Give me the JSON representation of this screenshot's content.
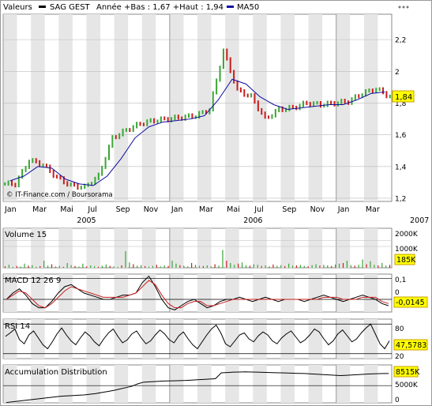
{
  "header": {
    "label_valeurs": "Valeurs",
    "series_name": "SAG GEST",
    "range_text": "Année +Bas : 1,67 +Haut : 1,94",
    "ma_label": "MA50",
    "credit": "© IT-Finance.com / Boursorama"
  },
  "colors": {
    "grid_band": "#e6e6e6",
    "up": "#3aa535",
    "down": "#c81e1e",
    "ma": "#1010a0",
    "badge_bg": "#ffff00",
    "badge_border": "#c8a000"
  },
  "icons": {
    "dots": "three-dots-icon"
  },
  "chart_data": [
    {
      "type": "line",
      "name": "price",
      "x": [
        "2005-01",
        "2005-02",
        "2005-03",
        "2005-04",
        "2005-05",
        "2005-06",
        "2005-07",
        "2005-08",
        "2005-09",
        "2005-10",
        "2005-11",
        "2005-12",
        "2006-01",
        "2006-02",
        "2006-03",
        "2006-04",
        "2006-05",
        "2006-06",
        "2006-07",
        "2006-08",
        "2006-09",
        "2006-10",
        "2006-11",
        "2006-12",
        "2007-01",
        "2007-02",
        "2007-03",
        "2007-04"
      ],
      "series": [
        {
          "values": [
            1.29,
            1.44,
            1.41,
            1.33,
            1.28,
            1.27,
            1.34,
            1.58,
            1.63,
            1.67,
            1.69,
            1.7,
            1.71,
            1.72,
            1.76,
            2.13,
            1.88,
            1.84,
            1.7,
            1.76,
            1.77,
            1.8,
            1.79,
            1.8,
            1.81,
            1.86,
            1.89,
            1.84
          ]
        },
        {
          "name": "MA50",
          "values": [
            1.31,
            1.34,
            1.4,
            1.39,
            1.32,
            1.29,
            1.28,
            1.34,
            1.45,
            1.58,
            1.65,
            1.68,
            1.69,
            1.7,
            1.72,
            1.82,
            1.95,
            1.92,
            1.84,
            1.79,
            1.76,
            1.77,
            1.78,
            1.79,
            1.79,
            1.82,
            1.86,
            1.87
          ]
        }
      ],
      "ylim": [
        1.18,
        2.36
      ],
      "y_ticks": [
        "1,2",
        "1,4",
        "1,6",
        "1,8",
        "2",
        "2,2"
      ],
      "x_tick_labels": [
        "Jan",
        "Mar",
        "Mai",
        "Jul",
        "Sep",
        "Nov",
        "Jan",
        "Mar",
        "Mai",
        "Jul",
        "Sep",
        "Nov",
        "Jan",
        "Mar"
      ],
      "year_labels": [
        "2005",
        "2006",
        "2007"
      ],
      "last_value_label": "1,84"
    },
    {
      "type": "bar",
      "title": "Volume 15",
      "values": [
        12,
        25,
        8,
        15,
        10,
        35,
        18,
        22,
        9,
        14,
        60,
        18,
        30,
        12,
        16,
        8,
        40,
        22,
        15,
        10,
        35,
        12,
        20,
        14,
        9,
        18,
        28,
        16,
        12,
        8,
        20,
        140,
        45,
        30,
        18,
        22,
        14,
        10,
        16,
        25,
        12,
        20,
        15,
        60,
        35,
        22,
        18,
        12,
        40,
        25,
        16,
        14,
        20,
        12,
        30,
        18,
        150,
        60,
        40,
        25,
        35,
        45,
        22,
        18,
        30,
        25,
        15,
        20,
        12,
        28,
        16,
        22,
        14,
        35,
        18,
        20,
        24,
        16,
        12,
        22,
        30,
        18,
        25,
        20,
        15,
        28,
        35,
        40,
        60,
        22,
        18,
        26,
        70,
        30,
        55,
        25,
        20,
        40,
        18,
        25
      ],
      "y_ticks": [
        "2000K",
        "1000K",
        "0"
      ],
      "ylim": [
        0,
        2000
      ],
      "last_value_label": "185K"
    },
    {
      "type": "line",
      "title": "MACD 12 26 9",
      "series": [
        {
          "values": [
            0.0,
            0.03,
            0.05,
            0.02,
            -0.02,
            -0.04,
            -0.04,
            -0.01,
            0.03,
            0.06,
            0.07,
            0.05,
            0.03,
            0.02,
            0.01,
            0.0,
            0.0,
            0.01,
            0.02,
            0.02,
            0.03,
            0.08,
            0.11,
            0.06,
            0.0,
            -0.04,
            -0.05,
            -0.03,
            -0.01,
            0.0,
            -0.02,
            -0.04,
            -0.03,
            -0.01,
            0.0,
            0.0,
            0.01,
            0.0,
            -0.01,
            0.0,
            0.01,
            0.0,
            -0.01,
            0.0,
            0.0,
            0.0,
            -0.01,
            0.0,
            0.01,
            0.02,
            0.01,
            0.0,
            -0.01,
            0.0,
            0.01,
            0.02,
            0.01,
            0.0,
            -0.02,
            -0.03
          ]
        },
        {
          "values": [
            0.0,
            0.02,
            0.04,
            0.03,
            0.0,
            -0.03,
            -0.04,
            -0.02,
            0.01,
            0.04,
            0.06,
            0.05,
            0.04,
            0.03,
            0.02,
            0.01,
            0.01,
            0.01,
            0.01,
            0.02,
            0.03,
            0.06,
            0.09,
            0.07,
            0.02,
            -0.02,
            -0.04,
            -0.04,
            -0.02,
            -0.01,
            -0.01,
            -0.03,
            -0.03,
            -0.02,
            -0.01,
            0.0,
            0.0,
            0.0,
            0.0,
            0.0,
            0.0,
            0.0,
            0.0,
            0.0,
            0.0,
            0.0,
            0.0,
            0.0,
            0.0,
            0.01,
            0.01,
            0.01,
            0.0,
            0.0,
            0.0,
            0.01,
            0.01,
            0.01,
            -0.01,
            -0.02
          ]
        }
      ],
      "ylim": [
        -0.06,
        0.12
      ],
      "y_ticks": [
        "0,1",
        "0"
      ],
      "last_value_label": "-0,0145"
    },
    {
      "type": "line",
      "title": "RSI 14",
      "series": [
        {
          "values": [
            55,
            62,
            70,
            48,
            40,
            58,
            66,
            52,
            38,
            30,
            44,
            60,
            72,
            58,
            46,
            38,
            52,
            64,
            56,
            44,
            36,
            50,
            62,
            70,
            55,
            42,
            48,
            60,
            66,
            52,
            40,
            46,
            58,
            68,
            60,
            48,
            42,
            56,
            64,
            50,
            38,
            30,
            44,
            58,
            70,
            78,
            62,
            40,
            34,
            46,
            58,
            62,
            50,
            44,
            56,
            64,
            58,
            46,
            40,
            52,
            60,
            66,
            54,
            42,
            48,
            58,
            70,
            64,
            50,
            38,
            46,
            60,
            68,
            56,
            44,
            50,
            62,
            72,
            80,
            60,
            40,
            30,
            46
          ]
        }
      ],
      "ylim": [
        10,
        90
      ],
      "y_ticks": [
        "80",
        "20"
      ],
      "last_value_label": "47,5783"
    },
    {
      "type": "area",
      "title": "Accumulation Distribution",
      "series": [
        {
          "values": [
            100,
            300,
            500,
            700,
            900,
            1100,
            1300,
            1500,
            1700,
            1900,
            2000,
            2100,
            2200,
            2300,
            2500,
            2700,
            3000,
            3300,
            3600,
            4000,
            4400,
            4800,
            5500,
            6000,
            6100,
            6200,
            6300,
            6350,
            6400,
            6450,
            6500,
            6600,
            6700,
            6800,
            6900,
            7000,
            8700,
            8800,
            8900,
            8950,
            9000,
            8950,
            8900,
            8850,
            8800,
            8750,
            8700,
            8650,
            8600,
            8550,
            8500,
            8400,
            8300,
            8200,
            8100,
            8000,
            7900,
            8000,
            8100,
            8200,
            8300,
            8400,
            8450,
            8500,
            8515
          ]
        }
      ],
      "ylim": [
        0,
        11000
      ],
      "y_ticks": [
        "5000K",
        "0"
      ],
      "last_value_label": "8515K"
    }
  ]
}
